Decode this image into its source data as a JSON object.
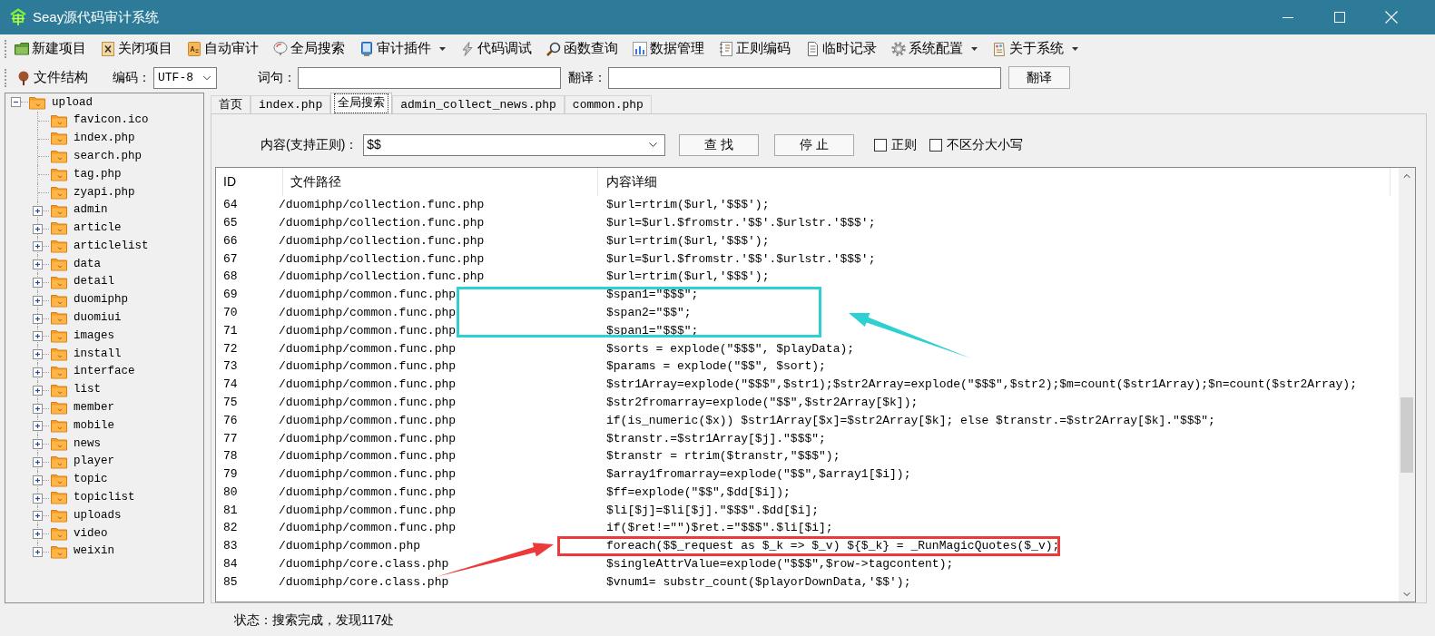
{
  "window": {
    "title": "Seay源代码审计系统"
  },
  "toolbar": [
    {
      "label": "新建项目",
      "menu": false
    },
    {
      "label": "关闭项目",
      "menu": false
    },
    {
      "label": "自动审计",
      "menu": false
    },
    {
      "label": "全局搜索",
      "menu": false
    },
    {
      "label": "审计插件",
      "menu": true
    },
    {
      "label": "代码调试",
      "menu": false
    },
    {
      "label": "函数查询",
      "menu": false
    },
    {
      "label": "数据管理",
      "menu": false
    },
    {
      "label": "正则编码",
      "menu": false
    },
    {
      "label": "临时记录",
      "menu": false
    },
    {
      "label": "系统配置",
      "menu": true
    },
    {
      "label": "关于系统",
      "menu": true
    }
  ],
  "toolbar2": {
    "tree_button": "文件结构",
    "encoding_label": "编码：",
    "encoding": "UTF-8",
    "phrase_label": "词句：",
    "translation_label": "翻译：",
    "translate_button": "翻译"
  },
  "tree": {
    "label": "upload",
    "expanded": true,
    "children": [
      {
        "label": "favicon.ico",
        "kind": "file"
      },
      {
        "label": "index.php",
        "kind": "file"
      },
      {
        "label": "search.php",
        "kind": "file"
      },
      {
        "label": "tag.php",
        "kind": "file"
      },
      {
        "label": "zyapi.php",
        "kind": "file"
      },
      {
        "label": "admin",
        "kind": "folder",
        "expanded": false
      },
      {
        "label": "article",
        "kind": "folder",
        "expanded": false
      },
      {
        "label": "articlelist",
        "kind": "folder",
        "expanded": false
      },
      {
        "label": "data",
        "kind": "folder",
        "expanded": false
      },
      {
        "label": "detail",
        "kind": "folder",
        "expanded": false
      },
      {
        "label": "duomiphp",
        "kind": "folder",
        "expanded": false
      },
      {
        "label": "duomiui",
        "kind": "folder",
        "expanded": false
      },
      {
        "label": "images",
        "kind": "folder",
        "expanded": false
      },
      {
        "label": "install",
        "kind": "folder",
        "expanded": false
      },
      {
        "label": "interface",
        "kind": "folder",
        "expanded": false
      },
      {
        "label": "list",
        "kind": "folder",
        "expanded": false
      },
      {
        "label": "member",
        "kind": "folder",
        "expanded": false
      },
      {
        "label": "mobile",
        "kind": "folder",
        "expanded": false
      },
      {
        "label": "news",
        "kind": "folder",
        "expanded": false
      },
      {
        "label": "player",
        "kind": "folder",
        "expanded": false
      },
      {
        "label": "topic",
        "kind": "folder",
        "expanded": false
      },
      {
        "label": "topiclist",
        "kind": "folder",
        "expanded": false
      },
      {
        "label": "uploads",
        "kind": "folder",
        "expanded": false
      },
      {
        "label": "video",
        "kind": "folder",
        "expanded": false
      },
      {
        "label": "weixin",
        "kind": "folder",
        "expanded": false
      }
    ]
  },
  "tabs": [
    {
      "label": "首页",
      "selected": false
    },
    {
      "label": "index.php",
      "selected": false
    },
    {
      "label": "全局搜索",
      "selected": true
    },
    {
      "label": "admin_collect_news.php",
      "selected": false
    },
    {
      "label": "common.php",
      "selected": false
    }
  ],
  "search": {
    "label": "内容(支持正则)：",
    "value": "$$",
    "find_button": "查 找",
    "stop_button": "停 止",
    "options": [
      {
        "label": "正则",
        "checked": false
      },
      {
        "label": "不区分大小写",
        "checked": false
      }
    ]
  },
  "table": {
    "columns": [
      "ID",
      "文件路径",
      "内容详细"
    ],
    "rows": [
      {
        "id": "64",
        "file": "/duomiphp/collection.func.php",
        "content": "$url=rtrim($url,'$$$');"
      },
      {
        "id": "65",
        "file": "/duomiphp/collection.func.php",
        "content": "$url=$url.$fromstr.'$$'.$urlstr.'$$$';"
      },
      {
        "id": "66",
        "file": "/duomiphp/collection.func.php",
        "content": "$url=rtrim($url,'$$$');"
      },
      {
        "id": "67",
        "file": "/duomiphp/collection.func.php",
        "content": "$url=$url.$fromstr.'$$'.$urlstr.'$$$';"
      },
      {
        "id": "68",
        "file": "/duomiphp/collection.func.php",
        "content": "$url=rtrim($url,'$$$');"
      },
      {
        "id": "69",
        "file": "/duomiphp/common.func.php",
        "content": "$span1=\"$$$\";"
      },
      {
        "id": "70",
        "file": "/duomiphp/common.func.php",
        "content": "$span2=\"$$\";"
      },
      {
        "id": "71",
        "file": "/duomiphp/common.func.php",
        "content": "$span1=\"$$$\";"
      },
      {
        "id": "72",
        "file": "/duomiphp/common.func.php",
        "content": "$sorts = explode(\"$$$\", $playData);"
      },
      {
        "id": "73",
        "file": "/duomiphp/common.func.php",
        "content": "$params = explode(\"$$\", $sort);"
      },
      {
        "id": "74",
        "file": "/duomiphp/common.func.php",
        "content": "$str1Array=explode(\"$$$\",$str1);$str2Array=explode(\"$$$\",$str2);$m=count($str1Array);$n=count($str2Array);"
      },
      {
        "id": "75",
        "file": "/duomiphp/common.func.php",
        "content": "$str2fromarray=explode(\"$$\",$str2Array[$k]);"
      },
      {
        "id": "76",
        "file": "/duomiphp/common.func.php",
        "content": "if(is_numeric($x)) $str1Array[$x]=$str2Array[$k]; else $transtr.=$str2Array[$k].\"$$$\";"
      },
      {
        "id": "77",
        "file": "/duomiphp/common.func.php",
        "content": "$transtr.=$str1Array[$j].\"$$$\";"
      },
      {
        "id": "78",
        "file": "/duomiphp/common.func.php",
        "content": "$transtr = rtrim($transtr,\"$$$\");"
      },
      {
        "id": "79",
        "file": "/duomiphp/common.func.php",
        "content": "$array1fromarray=explode(\"$$\",$array1[$i]);"
      },
      {
        "id": "80",
        "file": "/duomiphp/common.func.php",
        "content": "$ff=explode(\"$$\",$dd[$i]);"
      },
      {
        "id": "81",
        "file": "/duomiphp/common.func.php",
        "content": "$li[$j]=$li[$j].\"$$$\".$dd[$i];"
      },
      {
        "id": "82",
        "file": "/duomiphp/common.func.php",
        "content": "if($ret!=\"\")$ret.=\"$$$\".$li[$i];"
      },
      {
        "id": "83",
        "file": "/duomiphp/common.php",
        "content": "foreach($$_request as $_k => $_v) ${$_k} = _RunMagicQuotes($_v);"
      },
      {
        "id": "84",
        "file": "/duomiphp/core.class.php",
        "content": "$singleAttrValue=explode(\"$$$\",$row->tagcontent);"
      },
      {
        "id": "85",
        "file": "/duomiphp/core.class.php",
        "content": "$vnum1= substr_count($playorDownData,'$$');"
      }
    ]
  },
  "annotations": [
    {
      "kind": "box-arrow",
      "color": "#2fd0d4"
    },
    {
      "kind": "box-arrow",
      "color": "#ec3a3a"
    }
  ],
  "status_bar": "状态：搜索完成，发现117处"
}
